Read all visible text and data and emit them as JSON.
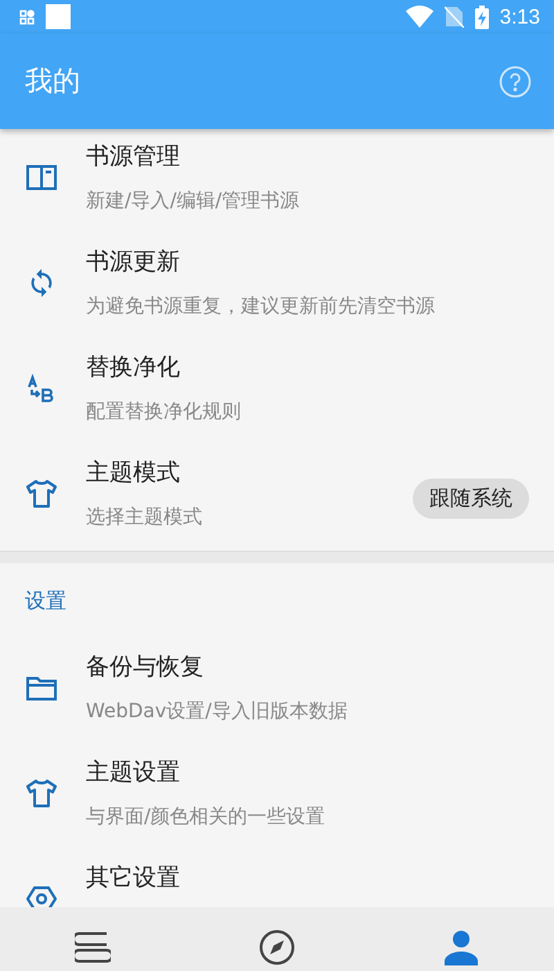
{
  "status_bar": {
    "time": "3:13"
  },
  "app_bar": {
    "title": "我的"
  },
  "menu": [
    {
      "kind": "book",
      "title": "书源管理",
      "subtitle": "新建/导入/编辑/管理书源"
    },
    {
      "kind": "sync",
      "title": "书源更新",
      "subtitle": "为避免书源重复，建议更新前先清空书源"
    },
    {
      "kind": "replace",
      "title": "替换净化",
      "subtitle": "配置替换净化规则"
    },
    {
      "kind": "shirt",
      "title": "主题模式",
      "subtitle": "选择主题模式",
      "value": "跟随系统"
    }
  ],
  "settings": {
    "title": "设置",
    "items": [
      {
        "kind": "folder",
        "title": "备份与恢复",
        "subtitle": "WebDav设置/导入旧版本数据"
      },
      {
        "kind": "shirt",
        "title": "主题设置",
        "subtitle": "与界面/颜色相关的一些设置"
      },
      {
        "kind": "gear",
        "title": "其它设置"
      }
    ]
  },
  "bottom_nav": [
    {
      "kind": "bookshelf",
      "selected": false
    },
    {
      "kind": "explore",
      "selected": false
    },
    {
      "kind": "profile",
      "selected": true
    }
  ]
}
